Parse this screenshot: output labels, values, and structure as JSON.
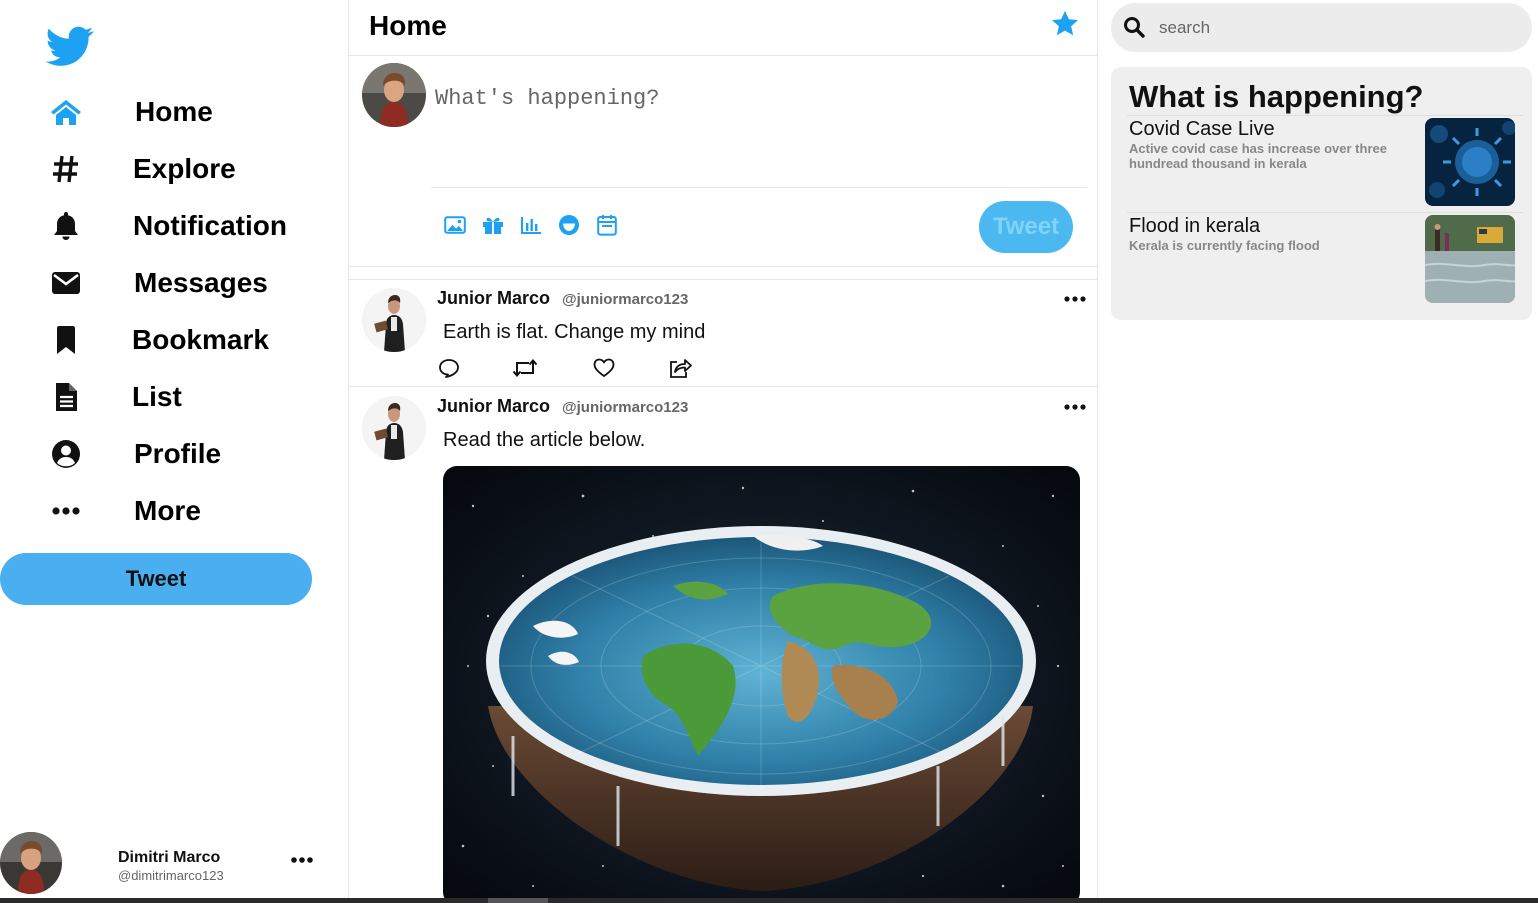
{
  "sidebar": {
    "logo": "twitter-bird-icon",
    "brand_color": "#1da1f2",
    "items": [
      {
        "label": "Home",
        "icon": "home-icon"
      },
      {
        "label": "Explore",
        "icon": "hashtag-icon"
      },
      {
        "label": "Notification",
        "icon": "bell-icon"
      },
      {
        "label": "Messages",
        "icon": "envelope-icon"
      },
      {
        "label": "Bookmark",
        "icon": "bookmark-icon"
      },
      {
        "label": "List",
        "icon": "list-document-icon"
      },
      {
        "label": "Profile",
        "icon": "user-circle-icon"
      },
      {
        "label": "More",
        "icon": "more-dots-icon"
      }
    ],
    "tweet_button": "Tweet",
    "profile": {
      "name": "Dimitri Marco",
      "handle": "@dimitrimarco123"
    }
  },
  "feed": {
    "title": "Home",
    "composer": {
      "placeholder": "What's happening?",
      "tweet_button": "Tweet"
    },
    "tools": [
      "image-icon",
      "gif-icon",
      "poll-icon",
      "emoji-icon",
      "schedule-icon"
    ],
    "posts": [
      {
        "name": "Junior Marco",
        "handle": "@juniormarco123",
        "text": "Earth is flat. Change my mind"
      },
      {
        "name": "Junior Marco",
        "handle": "@juniormarco123",
        "text": "Read the article below."
      }
    ]
  },
  "right": {
    "search": {
      "placeholder": "search"
    },
    "trends_title": "What is happening?",
    "trends": [
      {
        "headline": "Covid Case Live",
        "description": "Active covid case has increase over three hundread thousand in kerala"
      },
      {
        "headline": "Flood in kerala",
        "description": "Kerala is currently facing flood"
      }
    ]
  }
}
